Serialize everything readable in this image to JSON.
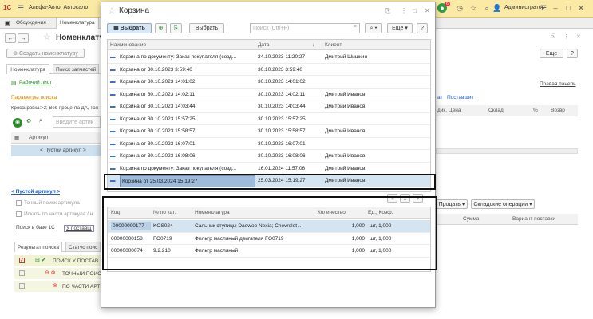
{
  "titlebar": {
    "app_title": "Альфа-Авто: Автосало",
    "user": "Администратор",
    "badge": "6"
  },
  "background": {
    "tab_discuss": "Обсуждения",
    "tab_nom": "Номенклатура",
    "form_title": "Номенклату",
    "create_btn": "Создать номенклатуру",
    "subtab1": "Номенклатура",
    "subtab2": "Поиск запчастей",
    "worksheet": "Рабочий лист",
    "search_params": "Параметры поиска",
    "cross_text": "Кроссировка:>2; Веб-процента ДА, Тол",
    "search_placeholder": "Введите артик",
    "col_article": "Артикул",
    "empty_article": "< Пустой артикул >",
    "empty_article2": "< Пустой артикул >",
    "opt1": "Точный поиск артикула",
    "opt2": "Искать по части артикула / н",
    "search_1c": "Поиск в базе 1С",
    "supplier_link": "У поставщ",
    "res_tab1": "Результат поиска",
    "res_tab2": "Статус поис",
    "res1": "ПОИСК У ПОСТАВ",
    "res2": "ТОЧНЫЙ ПОИС",
    "res3": "ПО ЧАСТИ АРТ",
    "right_more": "Еще",
    "right_panel": "Правая панель",
    "right_cols": {
      "c1": "дик, Цена",
      "c2": "Склад",
      "c3": "%",
      "c4": "Возвр"
    },
    "right_tabs": {
      "t1": "ат",
      "t2": "Поставщик"
    },
    "sell_btn": "Продать",
    "stock_btn": "Складские операции",
    "sum_col": "Сумма",
    "variant_col": "Вариант поставки"
  },
  "modal": {
    "title": "Корзина",
    "select_btn": "Выбрать",
    "select_btn2": "Выбрать",
    "search_placeholder": "Поиск (Ctrl+F)",
    "more_btn": "Еще",
    "help_btn": "?",
    "headers": {
      "name": "Наименование",
      "date": "Дата",
      "client": "Клиент"
    },
    "rows": [
      {
        "name": "Корзина по документу: Заказ покупателя (созд...",
        "date": "24.10.2023 11:20:27",
        "client": "Дмитрий Шишкин"
      },
      {
        "name": "Корзина от 30.10.2023 3:59:40",
        "date": "30.10.2023 3:59:40",
        "client": ""
      },
      {
        "name": "Корзина от 30.10.2023 14:01:02",
        "date": "30.10.2023 14:01:02",
        "client": ""
      },
      {
        "name": "Корзина от 30.10.2023 14:02:11",
        "date": "30.10.2023 14:02:11",
        "client": "Дмитрий Иванов"
      },
      {
        "name": "Корзина от 30.10.2023 14:03:44",
        "date": "30.10.2023 14:03:44",
        "client": "Дмитрий Иванов"
      },
      {
        "name": "Корзина от 30.10.2023 15:57:25",
        "date": "30.10.2023 15:57:25",
        "client": ""
      },
      {
        "name": "Корзина от 30.10.2023 15:58:57",
        "date": "30.10.2023 15:58:57",
        "client": "Дмитрий Иванов"
      },
      {
        "name": "Корзина от 30.10.2023 16:07:01",
        "date": "30.10.2023 16:07:01",
        "client": ""
      },
      {
        "name": "Корзина от 30.10.2023 16:08:06",
        "date": "30.10.2023 16:08:06",
        "client": "Дмитрий Иванов"
      },
      {
        "name": "Корзина по документу: Заказ покупателя (созд...",
        "date": "16.01.2024 11:57:06",
        "client": "Дмитрий Иванов"
      },
      {
        "name": "Корзина от 25.03.2024 15:19:27",
        "date": "25.03.2024 15:19:27",
        "client": "Дмитрий Иванов"
      }
    ],
    "detail_headers": {
      "code": "Код",
      "catnum": "№ по кат.",
      "nom": "Номенклатура",
      "qty": "Количество",
      "unit": "Ед., Коэф."
    },
    "detail_rows": [
      {
        "code": "00000000177",
        "catnum": "KOS024",
        "nom": "Сальник ступицы Daewoo Nexia; Chevrolet ...",
        "qty": "1,000",
        "unit": "шт, 1,000"
      },
      {
        "code": "00000000158",
        "catnum": "FO0719",
        "nom": "Фильтр масляный двигателя FO0719",
        "qty": "1,000",
        "unit": "шт, 1,000"
      },
      {
        "code": "00000000074",
        "catnum": "9.2.210",
        "nom": "Фильтр масляный",
        "qty": "1,000",
        "unit": "шт, 1,000"
      }
    ]
  }
}
